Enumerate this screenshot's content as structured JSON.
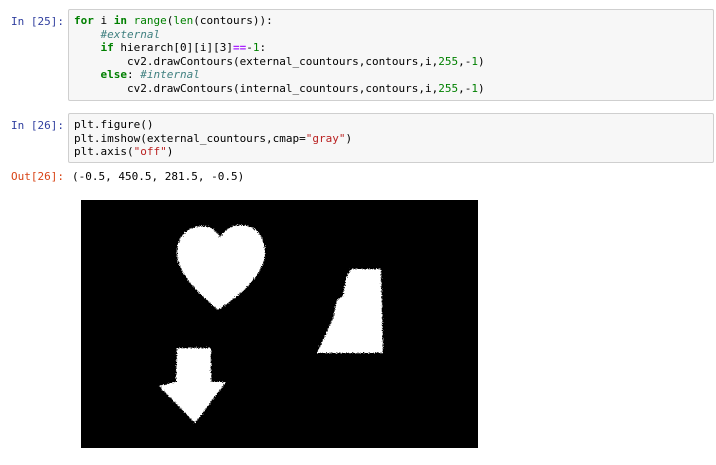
{
  "cells": [
    {
      "prompt": "In [25]:",
      "lines": [
        [
          [
            "kw",
            "for"
          ],
          [
            "",
            "i "
          ],
          [
            "kw",
            "in"
          ],
          [
            "",
            "",
            ""
          ],
          [
            "bi",
            "range"
          ],
          [
            "",
            "("
          ],
          [
            "bi",
            "len"
          ],
          [
            "",
            "(contours)):"
          ]
        ],
        [
          [
            "",
            "    "
          ],
          [
            "cm",
            "#external"
          ]
        ],
        [
          [
            "",
            "    "
          ],
          [
            "kw",
            "if"
          ],
          [
            "",
            "hierarch[0][i][3]"
          ],
          [
            "op",
            "=="
          ],
          [
            "",
            "-"
          ],
          [
            "num",
            "1"
          ],
          [
            "",
            ":"
          ]
        ],
        [
          [
            "",
            "        cv2.drawContours(external_countours,contours,i,"
          ],
          [
            "num",
            "255"
          ],
          [
            "",
            ",-"
          ],
          [
            "num",
            "1"
          ],
          [
            "",
            ")"
          ]
        ],
        [
          [
            "",
            "    "
          ],
          [
            "kw",
            "else"
          ],
          [
            "",
            ": "
          ],
          [
            "cm",
            "#internal"
          ]
        ],
        [
          [
            "",
            "        cv2.drawContours(internal_countours,contours,i,"
          ],
          [
            "num",
            "255"
          ],
          [
            "",
            ",-"
          ],
          [
            "num",
            "1"
          ],
          [
            "",
            ")"
          ]
        ]
      ]
    },
    {
      "prompt": "In [26]:",
      "lines": [
        [
          [
            "",
            "plt.figure()"
          ]
        ],
        [
          [
            "",
            "plt.imshow(external_countours,cmap="
          ],
          [
            "str",
            "\"gray\""
          ],
          [
            "",
            ")"
          ]
        ],
        [
          [
            "",
            "plt.axis("
          ],
          [
            "str",
            "\"off\""
          ],
          [
            "",
            ")"
          ]
        ]
      ]
    }
  ],
  "output": {
    "prompt": "Out[26]:",
    "text": "(-0.5, 450.5, 281.5, -0.5)"
  },
  "plot": {
    "background": "#000000",
    "foreground": "#ffffff",
    "shapes": [
      "heart",
      "triangle",
      "arrow-down"
    ]
  }
}
